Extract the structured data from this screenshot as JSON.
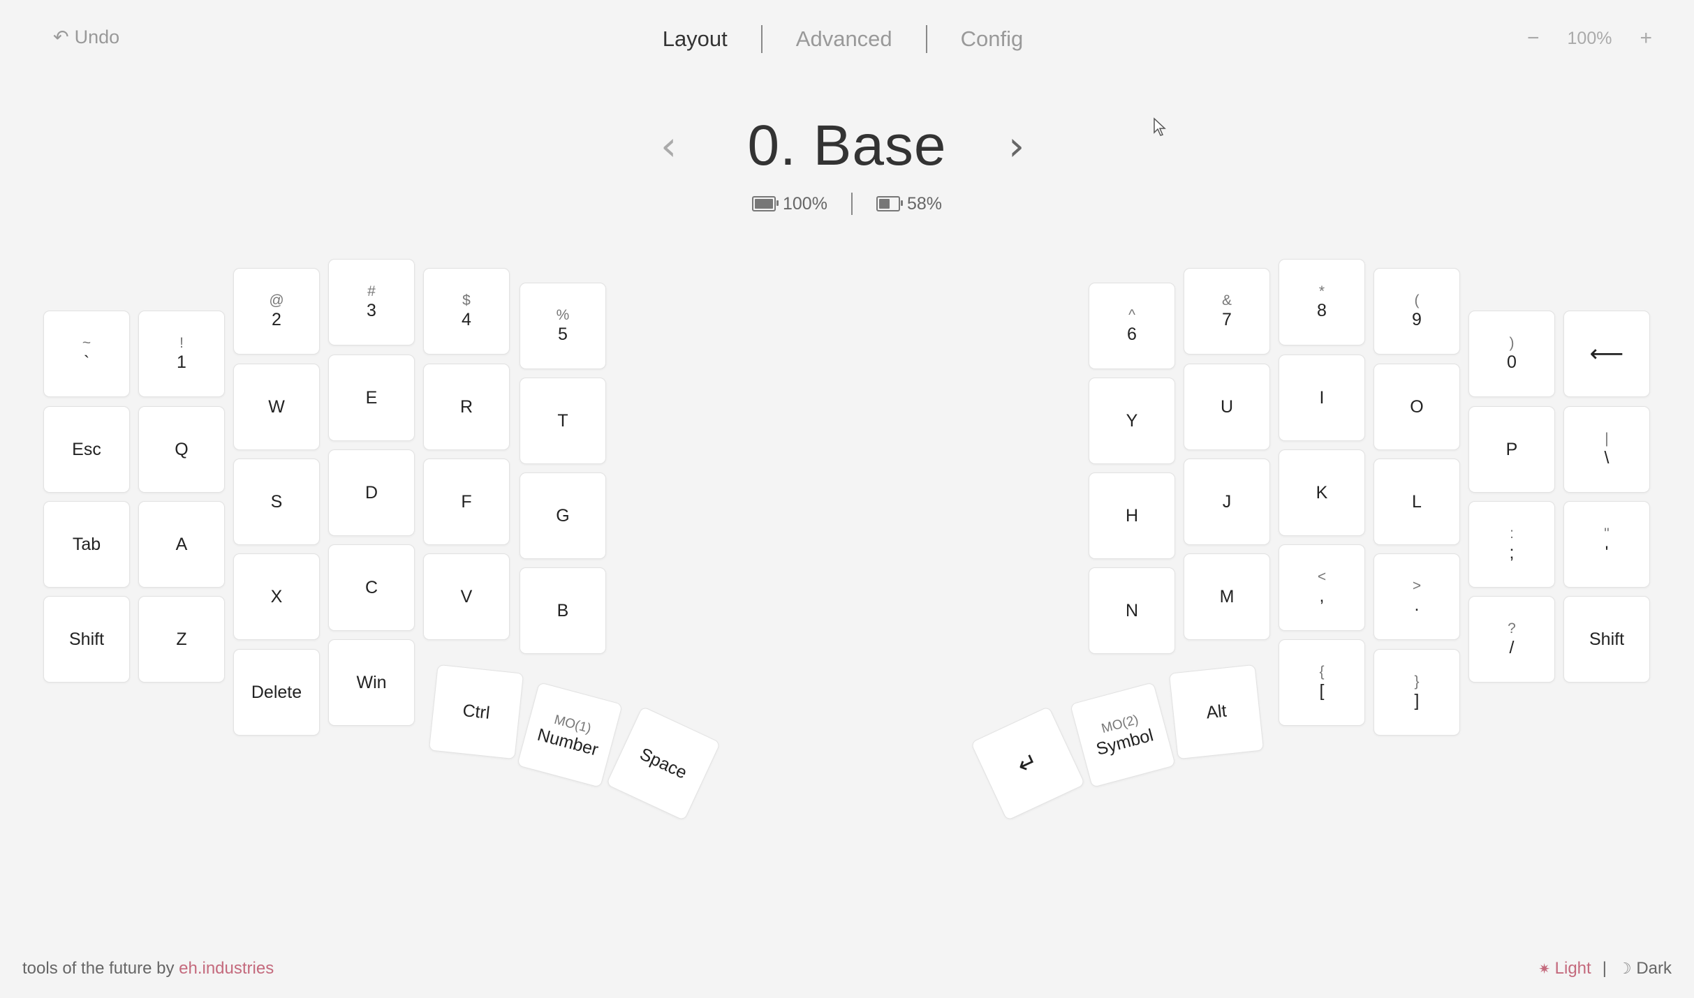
{
  "topbar": {
    "undo_icon": "undo-arrow-icon",
    "undo_label": "Undo",
    "tabs": [
      {
        "label": "Layout",
        "active": true
      },
      {
        "label": "Advanced",
        "active": false
      },
      {
        "label": "Config",
        "active": false
      }
    ],
    "zoom": {
      "minus": "−",
      "value": "100%",
      "plus": "+"
    }
  },
  "layer": {
    "title": "0. Base",
    "prev": "‹",
    "next": "›"
  },
  "battery": [
    {
      "value": "100%",
      "level": 1.0
    },
    {
      "value": "58%",
      "level": 0.58
    }
  ],
  "keys": {
    "k_grave": {
      "shift": "~",
      "main": "`"
    },
    "k_1": {
      "shift": "!",
      "main": "1"
    },
    "k_2": {
      "shift": "@",
      "main": "2"
    },
    "k_3": {
      "shift": "#",
      "main": "3"
    },
    "k_4": {
      "shift": "$",
      "main": "4"
    },
    "k_5": {
      "shift": "%",
      "main": "5"
    },
    "k_esc": {
      "main": "Esc"
    },
    "k_q": {
      "main": "Q"
    },
    "k_w": {
      "main": "W"
    },
    "k_e": {
      "main": "E"
    },
    "k_r": {
      "main": "R"
    },
    "k_t": {
      "main": "T"
    },
    "k_tab": {
      "main": "Tab"
    },
    "k_a": {
      "main": "A"
    },
    "k_s": {
      "main": "S"
    },
    "k_d": {
      "main": "D"
    },
    "k_f": {
      "main": "F"
    },
    "k_g": {
      "main": "G"
    },
    "k_lshift": {
      "main": "Shift"
    },
    "k_z": {
      "main": "Z"
    },
    "k_x": {
      "main": "X"
    },
    "k_c": {
      "main": "C"
    },
    "k_v": {
      "main": "V"
    },
    "k_b": {
      "main": "B"
    },
    "k_delete": {
      "main": "Delete"
    },
    "k_win": {
      "main": "Win"
    },
    "k_ctrl": {
      "main": "Ctrl"
    },
    "k_number": {
      "tag": "MO(1)",
      "main": "Number"
    },
    "k_space": {
      "main": "Space"
    },
    "k_6": {
      "shift": "^",
      "main": "6"
    },
    "k_7": {
      "shift": "&",
      "main": "7"
    },
    "k_8": {
      "shift": "*",
      "main": "8"
    },
    "k_9": {
      "shift": "(",
      "main": "9"
    },
    "k_0": {
      "shift": ")",
      "main": "0"
    },
    "k_bksp": {
      "main": "⟵"
    },
    "k_y": {
      "main": "Y"
    },
    "k_u": {
      "main": "U"
    },
    "k_i": {
      "main": "I"
    },
    "k_o": {
      "main": "O"
    },
    "k_p": {
      "main": "P"
    },
    "k_bslash": {
      "shift": "|",
      "main": "\\"
    },
    "k_h": {
      "main": "H"
    },
    "k_j": {
      "main": "J"
    },
    "k_k": {
      "main": "K"
    },
    "k_l": {
      "main": "L"
    },
    "k_semi": {
      "shift": ":",
      "main": ";"
    },
    "k_quote": {
      "shift": "\"",
      "main": "'"
    },
    "k_n": {
      "main": "N"
    },
    "k_m": {
      "main": "M"
    },
    "k_comma": {
      "shift": "<",
      "main": ","
    },
    "k_period": {
      "shift": ">",
      "main": "."
    },
    "k_slash": {
      "shift": "?",
      "main": "/"
    },
    "k_rshift": {
      "main": "Shift"
    },
    "k_lbrkt": {
      "shift": "{",
      "main": "["
    },
    "k_rbrkt": {
      "shift": "}",
      "main": "]"
    },
    "k_alt": {
      "main": "Alt"
    },
    "k_symbol": {
      "tag": "MO(2)",
      "main": "Symbol"
    },
    "k_enter": {
      "main": "↵"
    }
  },
  "footer": {
    "text": "tools of the future by ",
    "link": "eh.industries",
    "light_icon": "sun-icon",
    "light": "Light",
    "sep": "|",
    "dark_icon": "moon-icon",
    "dark": "Dark"
  }
}
